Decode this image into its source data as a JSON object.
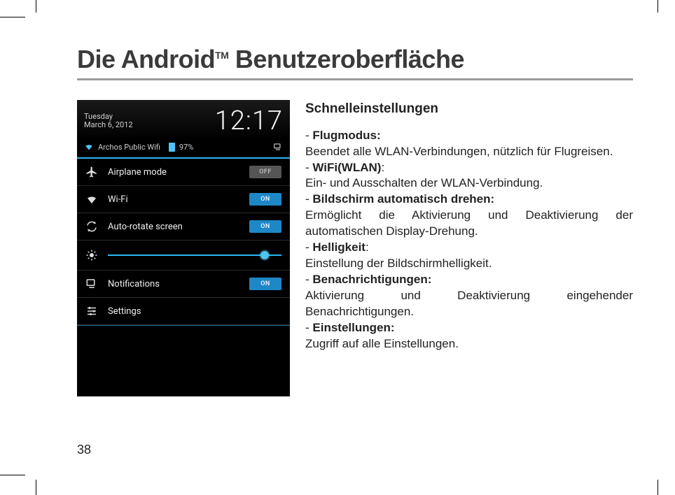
{
  "title_part1": "Die Android",
  "title_tm": "TM",
  "title_part2": " Benutzeroberfläche",
  "page_number": "38",
  "screenshot": {
    "date_line1": "Tuesday",
    "date_line2": "March 6, 2012",
    "clock": "12:17",
    "wifi_name": "Archos Public Wifi",
    "battery_pct": "97%",
    "rows": {
      "airplane": {
        "label": "Airplane mode",
        "state": "OFF"
      },
      "wifi": {
        "label": "Wi-Fi",
        "state": "ON"
      },
      "rotate": {
        "label": "Auto-rotate screen",
        "state": "ON"
      },
      "notif": {
        "label": "Notifications",
        "state": "ON"
      },
      "settings": {
        "label": "Settings"
      }
    }
  },
  "desc": {
    "heading": "Schnelleinstellungen",
    "flug_head": "Flugmodus:",
    "flug_body": "Beendet alle WLAN-Verbindungen, nützlich für Flugreisen.",
    "wifi_head": "WiFi(WLAN)",
    "wifi_body": "Ein- und  Ausschalten der WLAN-Verbindung.",
    "rotate_head": "Bildschirm automatisch drehen:",
    "rotate_body": "Ermöglicht die Aktivierung und Deaktivierung der automatischen Display-Drehung.",
    "bright_head": "Helligkeit",
    "bright_body": "Einstellung der Bildschirmhelligkeit.",
    "notif_head": "Benachrichtigungen:",
    "notif_body": "Aktivierung und Deaktivierung eingehender Benachrichtigungen.",
    "settings_head": "Einstellungen:",
    "settings_body": "Zugriff auf alle Einstellungen."
  }
}
